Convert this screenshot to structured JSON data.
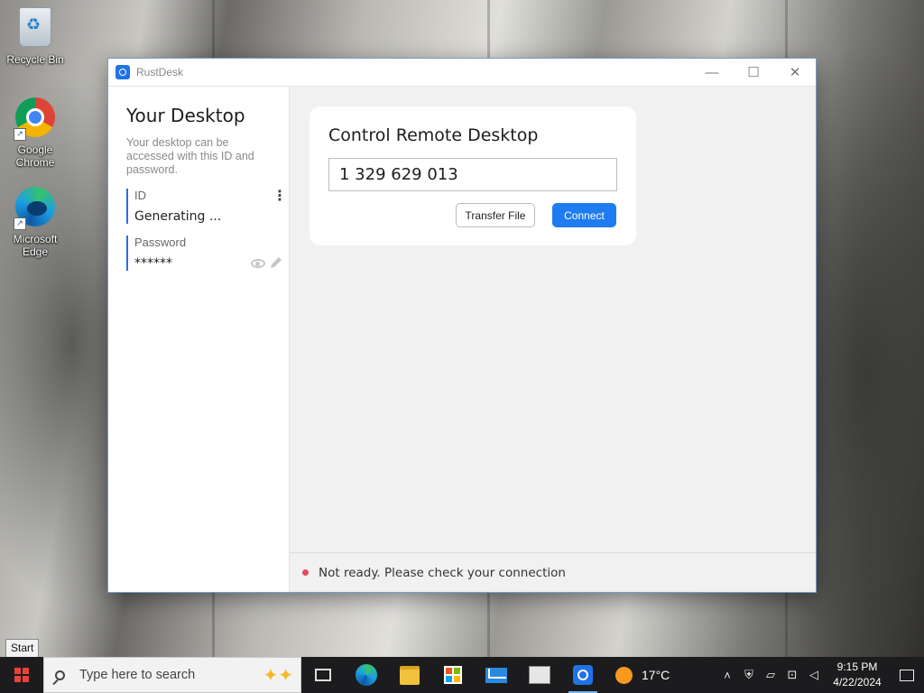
{
  "desktop": {
    "icons": [
      {
        "label": "Recycle Bin"
      },
      {
        "label": "Google Chrome"
      },
      {
        "label": "Microsoft Edge"
      }
    ]
  },
  "window": {
    "title": "RustDesk",
    "controls": {
      "minimize": "—",
      "maximize": "☐",
      "close": "✕"
    }
  },
  "left_panel": {
    "title": "Your Desktop",
    "description": "Your desktop can be accessed with this ID and password.",
    "id_label": "ID",
    "id_value": "Generating ...",
    "password_label": "Password",
    "password_value": "******"
  },
  "remote_card": {
    "title": "Control Remote Desktop",
    "id_input_value": "1 329 629 013",
    "transfer_button": "Transfer File",
    "connect_button": "Connect"
  },
  "status": {
    "text": "Not ready. Please check your connection",
    "color": "#e04f5f"
  },
  "taskbar": {
    "start_tooltip": "Start",
    "search_placeholder": "Type here to search",
    "weather": "17°C",
    "time": "9:15 PM",
    "date": "4/22/2024"
  },
  "colors": {
    "accent": "#1f7cf0",
    "status_dot": "#e04f5f"
  }
}
